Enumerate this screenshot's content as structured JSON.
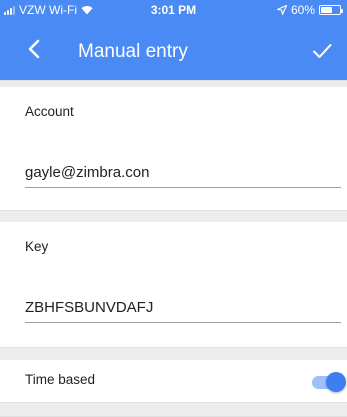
{
  "status_bar": {
    "carrier": "VZW Wi-Fi",
    "time": "3:01 PM",
    "battery_percent": "60%",
    "battery_level": 0.6,
    "signal_bars_filled": 3
  },
  "app_bar": {
    "title": "Manual entry",
    "back_icon": "chevron-left-icon",
    "confirm_icon": "check-icon"
  },
  "account": {
    "label": "Account",
    "value": "gayle@zimbra.con"
  },
  "key": {
    "label": "Key",
    "value": "ZBHFSBUNVDAFJ"
  },
  "time_based": {
    "label": "Time based",
    "enabled": true
  },
  "colors": {
    "header_blue": "#4a8af4",
    "toggle_thumb": "#3d7ef2",
    "toggle_track": "#9ec1fa",
    "separator": "#ececec"
  }
}
